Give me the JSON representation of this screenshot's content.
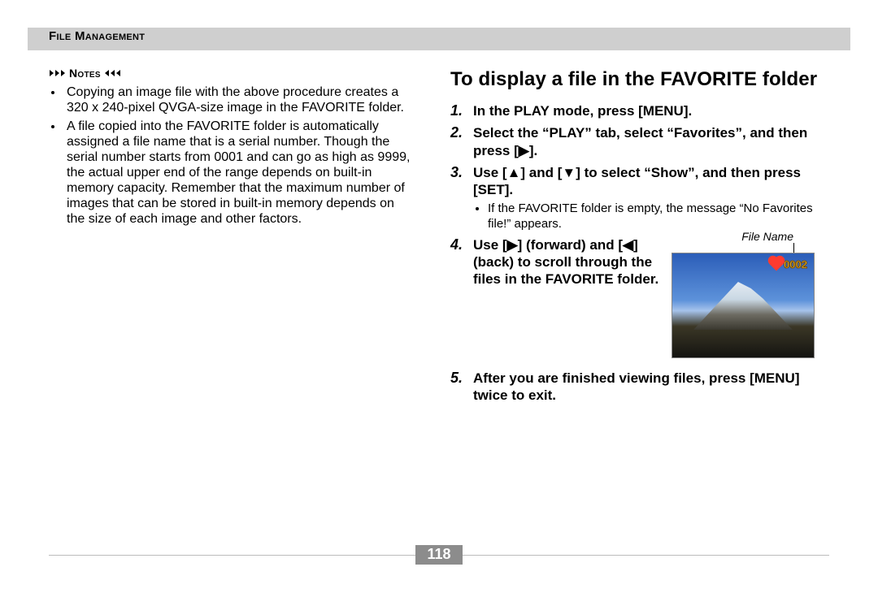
{
  "header": {
    "section_title": "File Management"
  },
  "left": {
    "notes_label": "Notes",
    "bullets": [
      "Copying an image file with the above procedure creates a 320 x 240-pixel QVGA-size image in the FAVORITE folder.",
      "A file copied into the FAVORITE folder is automatically assigned a file name that is a serial number. Though the serial number starts from 0001 and can go as high as 9999, the actual upper end of the range depends on built-in memory capacity. Remember that the maximum number of images that can be stored in built-in memory depends on the size of each image and other factors."
    ]
  },
  "right": {
    "title": "To display a file in the FAVORITE folder",
    "steps": [
      {
        "text": "In the PLAY mode, press [MENU]."
      },
      {
        "text": "Select the “PLAY” tab, select “Favorites”, and then press [▶]."
      },
      {
        "text": "Use [▲] and [▼] to select “Show”, and then press [SET].",
        "sub": "If the FAVORITE folder is empty, the message “No Favorites file!” appears."
      },
      {
        "text": "Use [▶] (forward) and [◀] (back) to scroll through the files in the FAVORITE folder."
      },
      {
        "text": "After you are finished viewing files, press [MENU] twice to exit."
      }
    ],
    "figure": {
      "caption": "File Name",
      "overlay_number": "0002"
    }
  },
  "page_number": "118"
}
